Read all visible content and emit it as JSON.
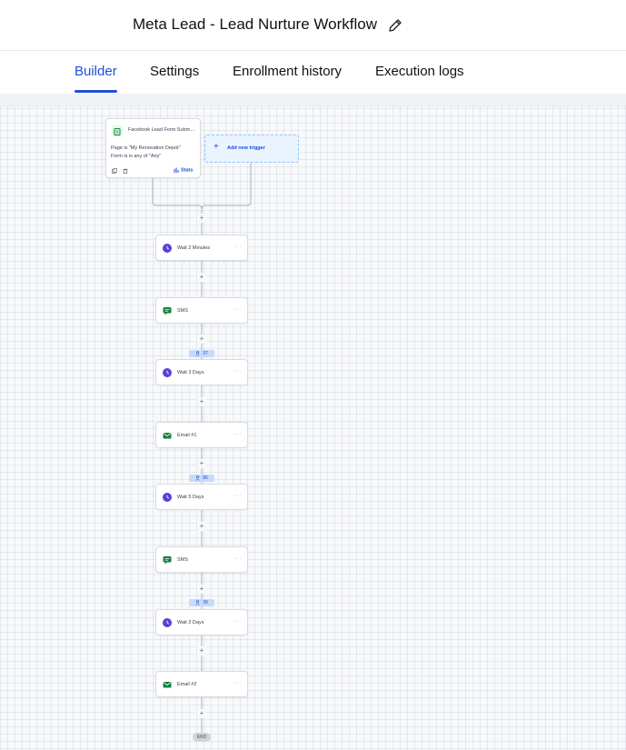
{
  "header": {
    "title": "Meta Lead - Lead Nurture Workflow",
    "edit_icon": "pencil-icon"
  },
  "tabs": [
    {
      "label": "Builder",
      "active": true
    },
    {
      "label": "Settings",
      "active": false
    },
    {
      "label": "Enrollment history",
      "active": false
    },
    {
      "label": "Execution logs",
      "active": false
    }
  ],
  "trigger": {
    "icon": "lead-form-icon",
    "title": "Facebook Lead Form Submitted",
    "conditions": [
      "Page is \"My Renovation Depot\"",
      "Form is is any of \"Any\""
    ],
    "stats_label": "Stats"
  },
  "add_trigger": {
    "label": "Add new trigger"
  },
  "steps": [
    {
      "type": "wait",
      "label": "Wait 2 Minutes",
      "icon": "clock-icon"
    },
    {
      "type": "sms",
      "label": "SMS",
      "icon": "chat-icon"
    },
    {
      "type": "wait",
      "label": "Wait 3 Days",
      "icon": "clock-icon"
    },
    {
      "type": "email",
      "label": "Email #1",
      "icon": "mail-icon"
    },
    {
      "type": "wait",
      "label": "Wait 5 Days",
      "icon": "clock-icon"
    },
    {
      "type": "sms",
      "label": "SMS",
      "icon": "chat-icon"
    },
    {
      "type": "wait",
      "label": "Wait 2 Days",
      "icon": "clock-icon"
    },
    {
      "type": "email",
      "label": "Email #2",
      "icon": "mail-icon"
    }
  ],
  "step_menu_label": "···",
  "add_step_label": "+",
  "waiting_counts": [
    {
      "before_step": 2,
      "count": "37"
    },
    {
      "before_step": 4,
      "count": "86"
    },
    {
      "before_step": 6,
      "count": "39"
    }
  ],
  "end_label": "END",
  "colors": {
    "accent": "#1d4ed8",
    "wait_icon": "#5b3fd6",
    "message_icon": "#15803d",
    "badge_bg": "#c7dcfb"
  }
}
